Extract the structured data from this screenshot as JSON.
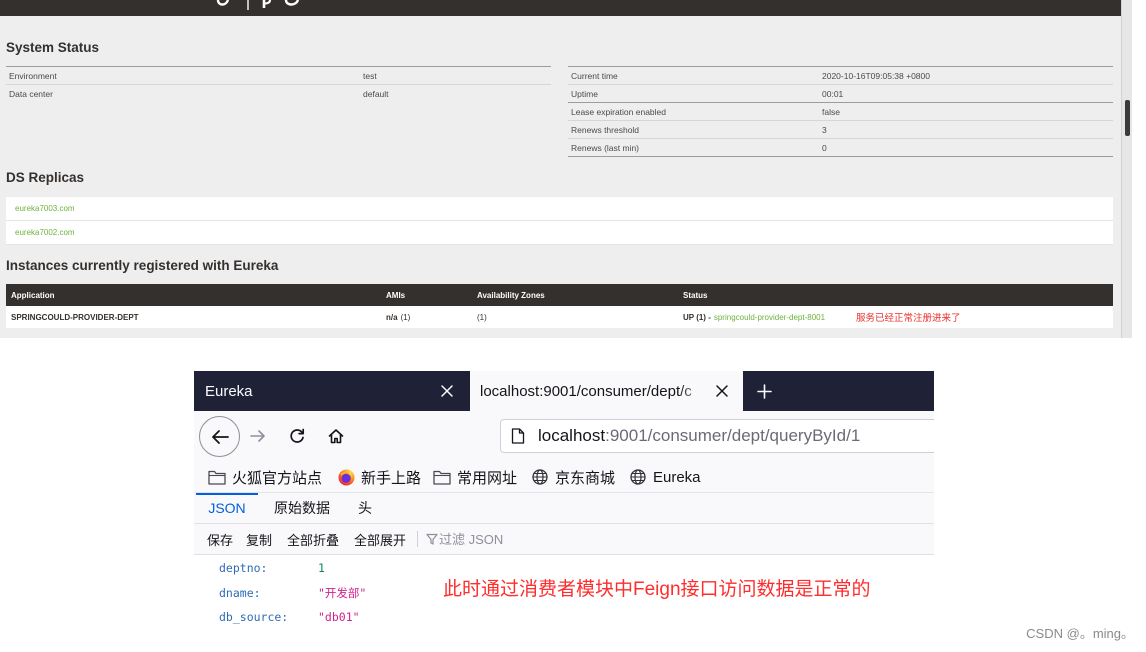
{
  "colors": {
    "eureka_dark": "#34302d",
    "eureka_green": "#6db33f",
    "note_red": "#e8302c",
    "annotation_red": "#ff2d2d",
    "tab_bar": "#1f2137",
    "accent_blue": "#0060df",
    "json_key": "#2f6cb3",
    "json_number": "#0d8a5c",
    "json_string": "#d1218d"
  },
  "eureka": {
    "system_status": {
      "heading": "System Status",
      "general": [
        {
          "label": "Environment",
          "value": "test"
        },
        {
          "label": "Data center",
          "value": "default"
        }
      ],
      "lease": [
        {
          "label": "Current time",
          "value": "2020-10-16T09:05:38 +0800"
        },
        {
          "label": "Uptime",
          "value": "00:01"
        },
        {
          "label": "Lease expiration enabled",
          "value": "false"
        },
        {
          "label": "Renews threshold",
          "value": "3"
        },
        {
          "label": "Renews (last min)",
          "value": "0"
        }
      ]
    },
    "replicas": {
      "heading": "DS Replicas",
      "items": [
        "eureka7003.com",
        "eureka7002.com"
      ]
    },
    "instances": {
      "heading": "Instances currently registered with Eureka",
      "columns": [
        "Application",
        "AMIs",
        "Availability Zones",
        "Status"
      ],
      "rows": [
        {
          "application": "SPRINGCOULD-PROVIDER-DEPT",
          "amis": "n/a",
          "amis_count": "(1)",
          "zones": "(1)",
          "status": "UP (1) -",
          "instance_link": "springcould-provider-dept-8001",
          "note": "服务已经正常注册进来了"
        }
      ]
    }
  },
  "browser": {
    "tabs": [
      {
        "title": "Eureka",
        "active": false
      },
      {
        "title": "localhost:9001/consumer/dept/c",
        "active": true
      }
    ],
    "url": {
      "host": "localhost",
      "path": ":9001/consumer/dept/queryById/1"
    },
    "bookmarks": [
      {
        "icon": "folder-icon",
        "label": "火狐官方站点"
      },
      {
        "icon": "firefox-icon",
        "label": "新手上路"
      },
      {
        "icon": "folder-icon",
        "label": "常用网址"
      },
      {
        "icon": "globe-icon",
        "label": "京东商城"
      },
      {
        "icon": "globe-icon",
        "label": "Eureka"
      }
    ],
    "json_viewer": {
      "tabs": [
        "JSON",
        "原始数据",
        "头"
      ],
      "active_index": 0,
      "toolbar": [
        "保存",
        "复制",
        "全部折叠",
        "全部展开"
      ],
      "filter_placeholder": "过滤 JSON",
      "rows": [
        {
          "key": "deptno:",
          "value": "1"
        },
        {
          "key": "dname:",
          "value": "\"开发部\""
        },
        {
          "key": "db_source:",
          "value": "\"db01\""
        }
      ]
    }
  },
  "annotation": "此时通过消费者模块中Feign接口访问数据是正常的",
  "watermark": "CSDN @。ming。"
}
